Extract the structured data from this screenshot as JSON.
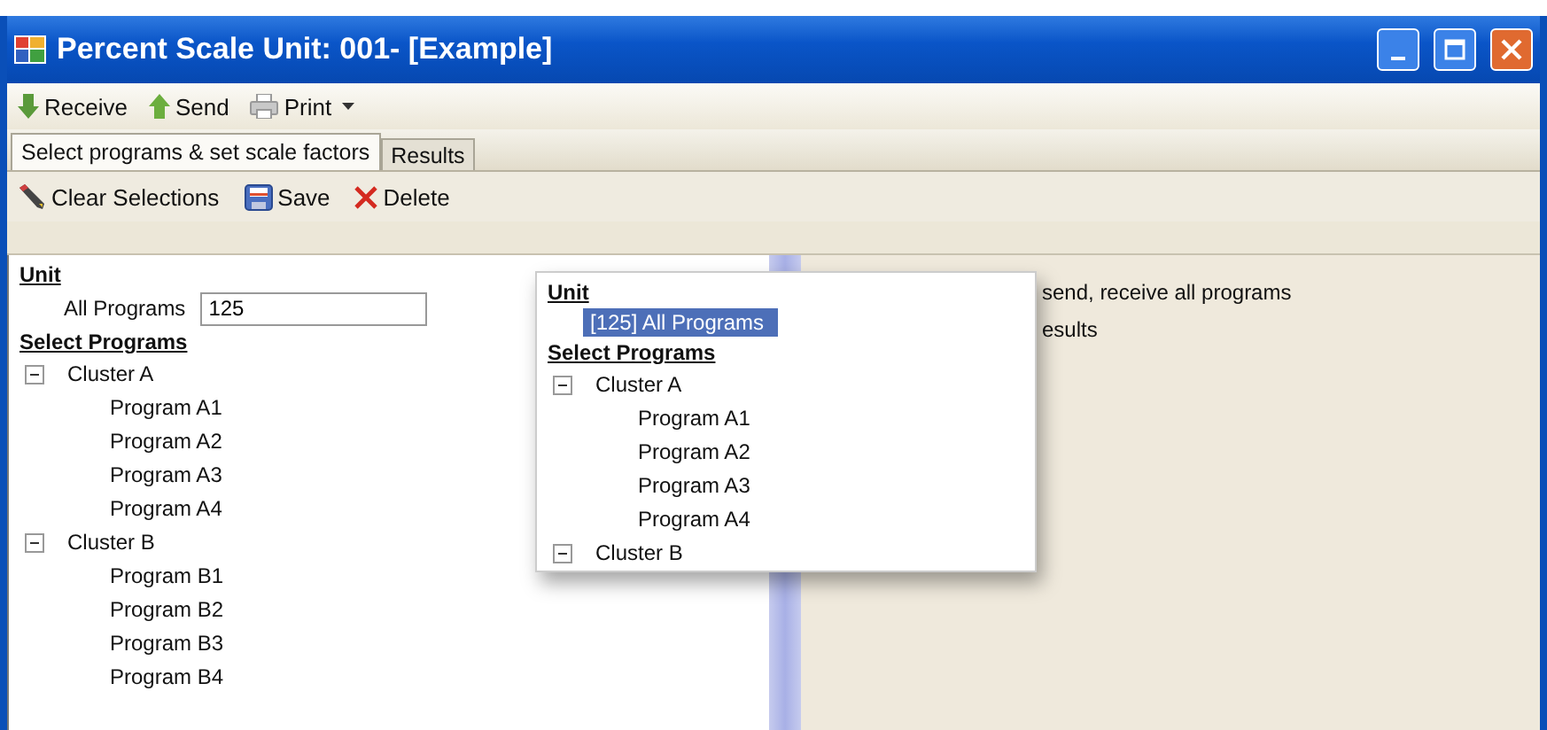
{
  "window": {
    "title": "Percent Scale Unit: 001- [Example]"
  },
  "toolbar": [
    {
      "label": "Receive",
      "dropdown": false
    },
    {
      "label": "Send",
      "dropdown": false
    },
    {
      "label": "Print",
      "dropdown": true
    }
  ],
  "tabs": [
    {
      "label": "Select programs & set scale factors",
      "selected": true
    },
    {
      "label": "Results",
      "selected": false
    }
  ],
  "actions": [
    {
      "label": "Clear Selections"
    },
    {
      "label": "Save"
    },
    {
      "label": "Delete"
    }
  ],
  "left_panel": {
    "unit_heading": "Unit",
    "all_programs_label": "All Programs",
    "all_programs_value": "125",
    "select_heading": "Select Programs",
    "clusters": [
      {
        "label": "Cluster A",
        "expanded": true,
        "children": [
          {
            "label": "Program A1"
          },
          {
            "label": "Program A2"
          },
          {
            "label": "Program A3"
          },
          {
            "label": "Program A4"
          }
        ]
      },
      {
        "label": "Cluster B",
        "expanded": true,
        "children": [
          {
            "label": "Program B1"
          },
          {
            "label": "Program B2"
          },
          {
            "label": "Program B3"
          },
          {
            "label": "Program B4"
          }
        ]
      }
    ]
  },
  "popup": {
    "unit_heading": "Unit",
    "selected_item": "[125] All Programs",
    "select_heading": "Select Programs",
    "clusters": [
      {
        "label": "Cluster A",
        "expanded": true,
        "children": [
          {
            "label": "Program A1"
          },
          {
            "label": "Program A2"
          },
          {
            "label": "Program A3"
          },
          {
            "label": "Program A4"
          }
        ]
      },
      {
        "label": "Cluster B",
        "expanded": true
      }
    ]
  },
  "info_lines": [
    "send, receive all programs",
    "esults"
  ]
}
